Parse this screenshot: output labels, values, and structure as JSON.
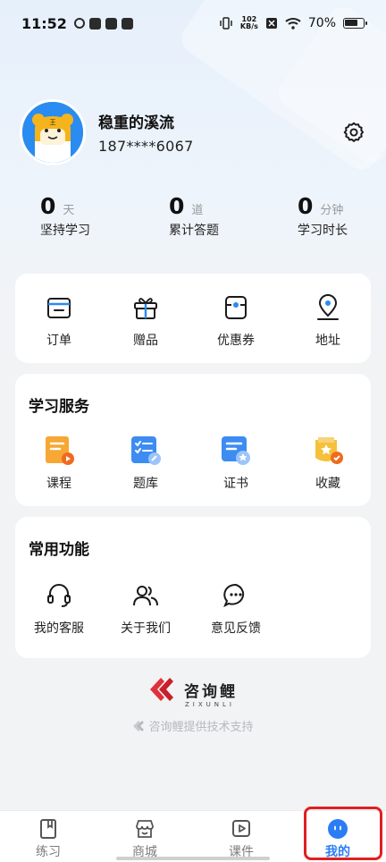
{
  "status_bar": {
    "time": "11:52",
    "net_speed_value": "102",
    "net_speed_unit": "KB/s",
    "battery": "70%"
  },
  "profile": {
    "name": "稳重的溪流",
    "phone": "187****6067"
  },
  "stats": [
    {
      "value": "0",
      "unit": "天",
      "label": "坚持学习"
    },
    {
      "value": "0",
      "unit": "道",
      "label": "累计答题"
    },
    {
      "value": "0",
      "unit": "分钟",
      "label": "学习时长"
    }
  ],
  "quick_actions": [
    {
      "label": "订单",
      "icon": "wallet-icon"
    },
    {
      "label": "赠品",
      "icon": "gift-icon"
    },
    {
      "label": "优惠券",
      "icon": "coupon-icon"
    },
    {
      "label": "地址",
      "icon": "location-icon"
    }
  ],
  "study_services": {
    "title": "学习服务",
    "items": [
      {
        "label": "课程",
        "icon": "course-icon"
      },
      {
        "label": "题库",
        "icon": "question-bank-icon"
      },
      {
        "label": "证书",
        "icon": "certificate-icon"
      },
      {
        "label": "收藏",
        "icon": "favorite-icon"
      }
    ]
  },
  "common_functions": {
    "title": "常用功能",
    "items": [
      {
        "label": "我的客服",
        "icon": "headset-icon"
      },
      {
        "label": "关于我们",
        "icon": "users-icon"
      },
      {
        "label": "意见反馈",
        "icon": "chat-bubble-icon"
      }
    ]
  },
  "brand": {
    "name": "咨询鲤",
    "latin": "ZIXUNLI",
    "support_text": "咨询鲤提供技术支持"
  },
  "bottom_nav": [
    {
      "label": "练习",
      "icon": "practice-icon",
      "active": false
    },
    {
      "label": "商城",
      "icon": "store-icon",
      "active": false
    },
    {
      "label": "课件",
      "icon": "courseware-icon",
      "active": false
    },
    {
      "label": "我的",
      "icon": "profile-face-icon",
      "active": true
    }
  ],
  "colors": {
    "accent": "#2a7df5",
    "highlight": "#e02020",
    "brand_red": "#e0303a"
  }
}
